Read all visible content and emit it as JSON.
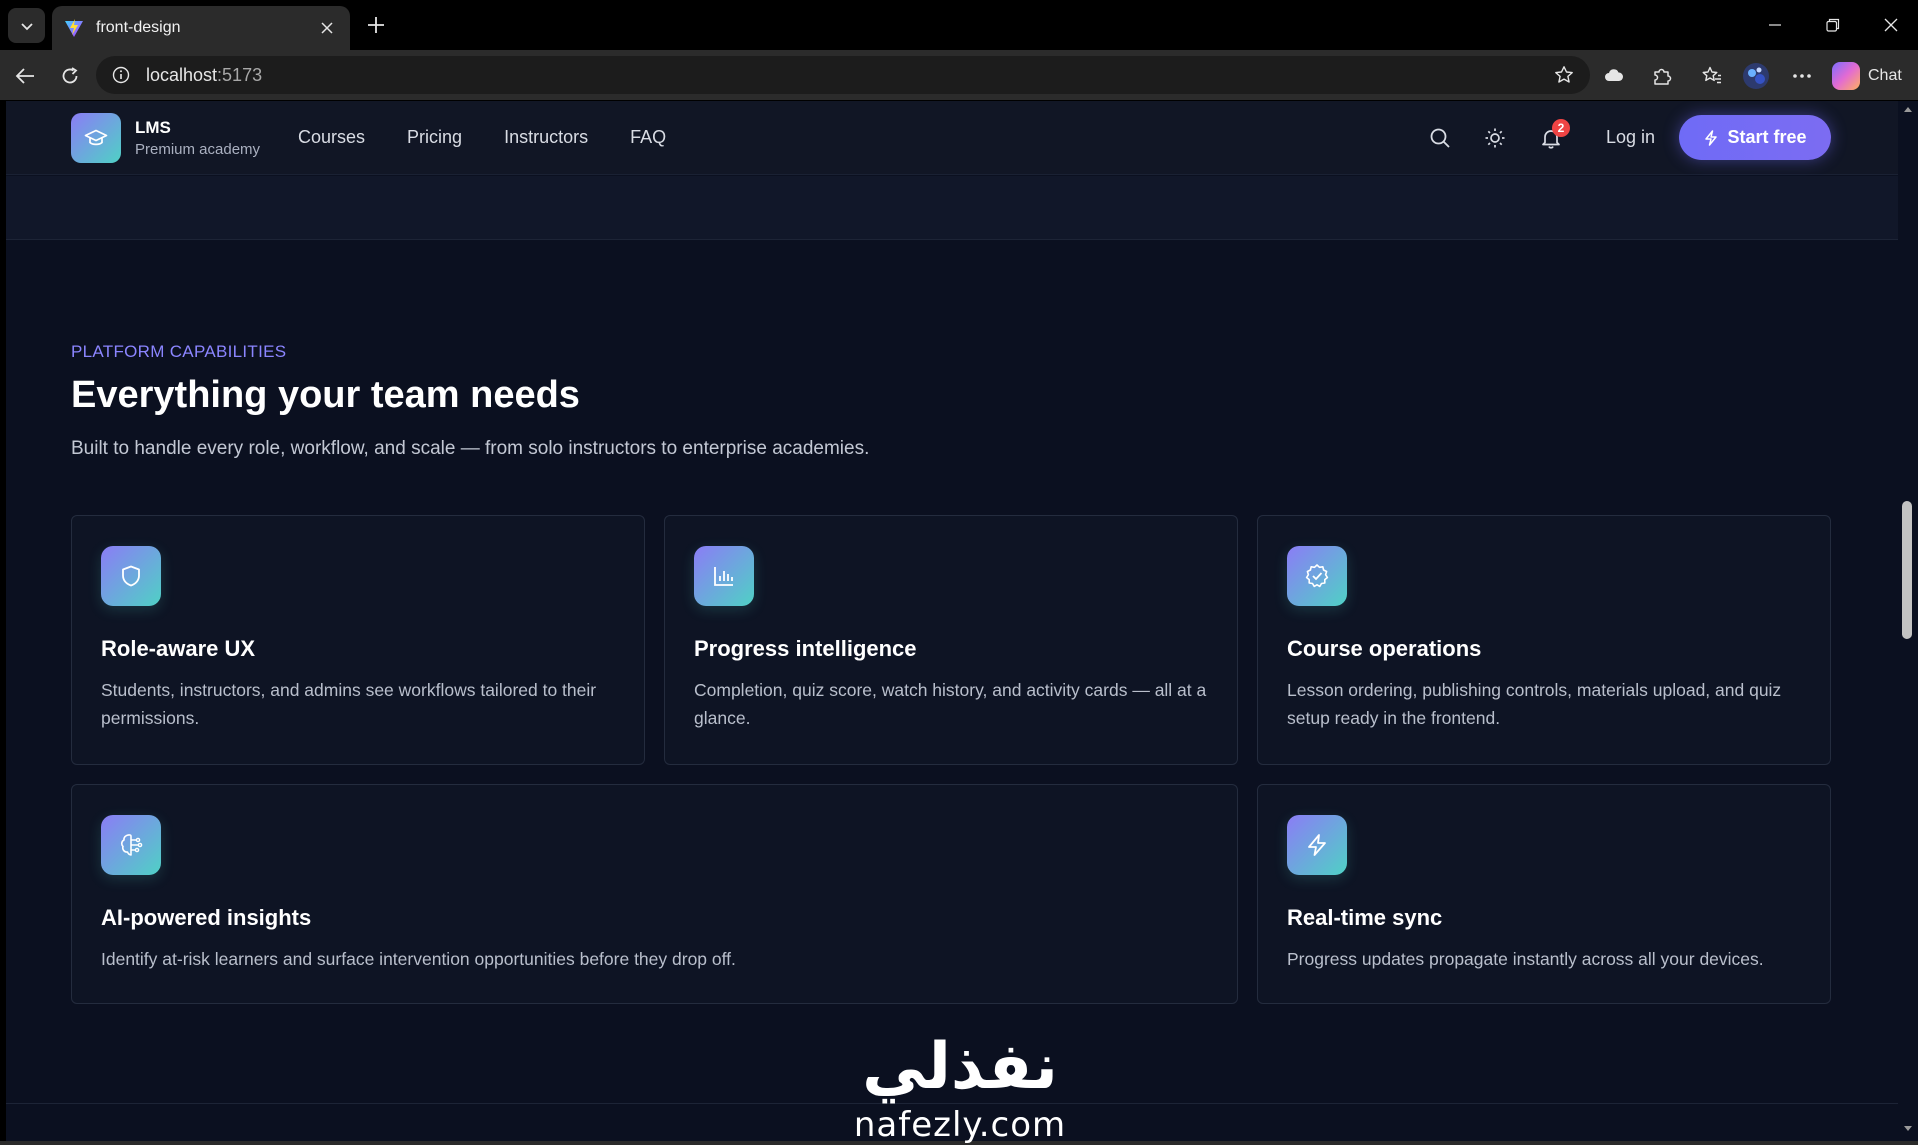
{
  "browser": {
    "tab_title": "front-design",
    "url_host": "localhost",
    "url_port": ":5173",
    "chat_label": "Chat"
  },
  "nav": {
    "brand_name": "LMS",
    "brand_sub": "Premium academy",
    "links": [
      "Courses",
      "Pricing",
      "Instructors",
      "FAQ"
    ],
    "notification_count": "2",
    "login": "Log in",
    "cta": "Start free"
  },
  "section": {
    "eyebrow": "PLATFORM CAPABILITIES",
    "headline": "Everything your team needs",
    "subhead": "Built to handle every role, workflow, and scale — from solo instructors to enterprise academies."
  },
  "cards": [
    {
      "icon": "shield-icon",
      "title": "Role-aware UX",
      "desc": "Students, instructors, and admins see workflows tailored to their permissions."
    },
    {
      "icon": "bar-chart-icon",
      "title": "Progress intelligence",
      "desc": "Completion, quiz score, watch history, and activity cards — all at a glance."
    },
    {
      "icon": "badge-check-icon",
      "title": "Course operations",
      "desc": "Lesson ordering, publishing controls, materials upload, and quiz setup ready in the frontend."
    },
    {
      "icon": "brain-icon",
      "title": "AI-powered insights",
      "desc": "Identify at-risk learners and surface intervention opportunities before they drop off."
    },
    {
      "icon": "lightning-icon",
      "title": "Real-time sync",
      "desc": "Progress updates propagate instantly across all your devices."
    }
  ],
  "watermark": {
    "arabic": "نفذلي",
    "latin": "nafezly.com"
  },
  "colors": {
    "accent": "#7c6cf2",
    "page_bg": "#0b1020",
    "card_bg": "#0e1424",
    "eyebrow": "#8b85ff",
    "badge": "#ef4444"
  }
}
